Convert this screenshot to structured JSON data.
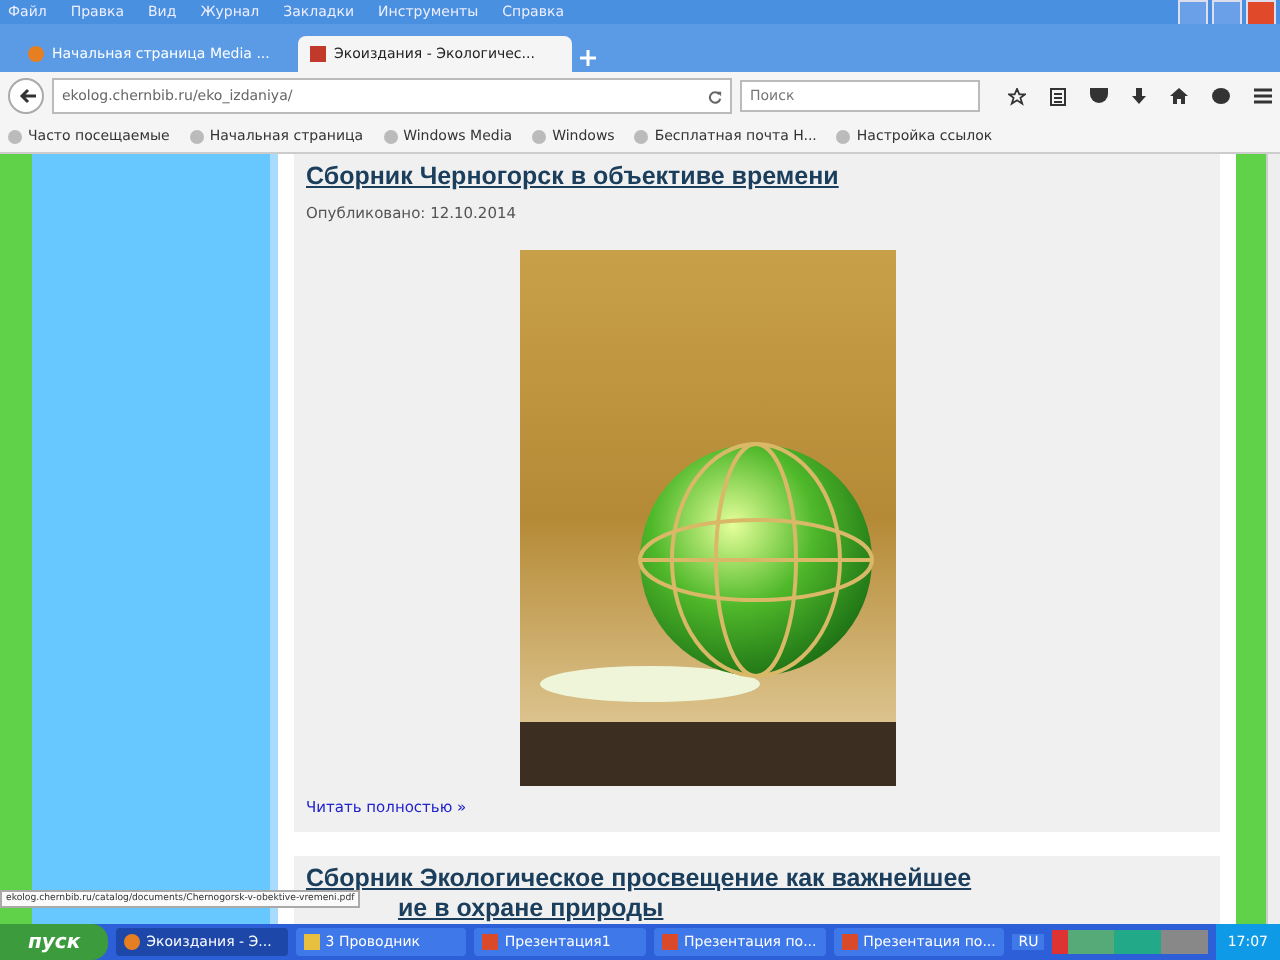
{
  "menu": [
    "Файл",
    "Правка",
    "Вид",
    "Журнал",
    "Закладки",
    "Инструменты",
    "Справка"
  ],
  "tabs": [
    {
      "label": "Начальная страница Media ...",
      "selected": false
    },
    {
      "label": "Экоиздания - Экологичес...",
      "selected": true
    }
  ],
  "address": {
    "value": "ekolog.chernbib.ru/eko_izdaniya/"
  },
  "search": {
    "placeholder": "Поиск"
  },
  "bookmarks": [
    "Часто посещаемые",
    "Начальная страница",
    "Windows Media",
    "Windows",
    "Бесплатная почта H...",
    "Настройка ссылок"
  ],
  "articles": [
    {
      "title_lines": [
        "Сборник Черногорск в объективе времени"
      ],
      "date": "Опубликовано: 12.10.2014",
      "kind": "with-cover",
      "more": "Читать полностью »"
    },
    {
      "title_lines": [
        "Сборник Экологическое просвещение как важнейшее",
        "ие в охране природы"
      ],
      "kind": "text-only"
    }
  ],
  "status_url": "ekolog.chernbib.ru/catalog/documents/Chernogorsk-v-obektive-vremeni.pdf",
  "taskbar": {
    "start": "пуск",
    "items": [
      {
        "label": "Экоиздания - Э...",
        "selected": true,
        "kind": "browser"
      },
      {
        "label": "3 Проводник",
        "selected": false,
        "kind": "folder"
      },
      {
        "label": "Презентация1",
        "selected": false,
        "kind": "document"
      },
      {
        "label": "Презентация по...",
        "selected": false,
        "kind": "document"
      },
      {
        "label": "Презентация по...",
        "selected": false,
        "kind": "document"
      }
    ],
    "language": "RU",
    "clock": "17:07"
  }
}
